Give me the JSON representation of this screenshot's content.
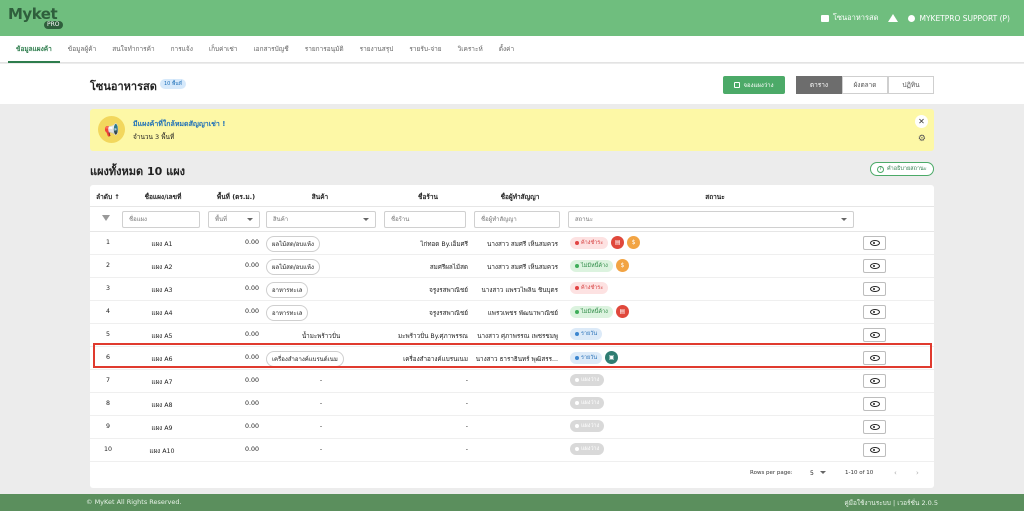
{
  "app": {
    "logo": "Myket",
    "logo_sub": "PRO"
  },
  "topbar": {
    "shop_label": "โซนอาหารสด",
    "user_label": "MYKETPRO SUPPORT (P)"
  },
  "menu": [
    "ข้อมูลแผงค้า",
    "ข้อมูลผู้ค้า",
    "สนใจทำการค้า",
    "การแจ้ง",
    "เก็บค่าเช่า",
    "เอกสารบัญชี",
    "รายการอนุมัติ",
    "รายงานสรุป",
    "รายรับ-จ่าย",
    "วิเคราะห์",
    "ตั้งค่า"
  ],
  "page": {
    "title": "โซนอาหารสด",
    "count_badge": "10 พื้นที่",
    "reserve_button": "จองแผงว่าง",
    "views": [
      "ตาราง",
      "ผังตลาด",
      "ปฏิทิน"
    ],
    "active_view": "ตาราง"
  },
  "alert": {
    "title": "มีแผงค้าที่ใกล้หมดสัญญาเช่า !",
    "sub": "จำนวน 3 พื้นที่"
  },
  "section": {
    "title": "แผงทั้งหมด 10 แผง",
    "status_help": "คำอธิบายสถานะ"
  },
  "table": {
    "headers": [
      "ลำดับ",
      "ชื่อแผง/เลขที่",
      "พื้นที่ (ตร.ม.)",
      "สินค้า",
      "ชื่อร้าน",
      "ชื่อผู้ทำสัญญา",
      "สถานะ"
    ],
    "filters": {
      "name": "ชื่อแผง",
      "area": "พื้นที่",
      "product": "สินค้า",
      "shop": "ชื่อร้าน",
      "tenant": "ชื่อผู้ทำสัญญา",
      "status": "สถานะ"
    },
    "rows": [
      {
        "no": "1",
        "name": "แผง A1",
        "area": "0.00",
        "product": "ผลไม้สด/อบแห้ง",
        "product_chip": true,
        "shop": "ไก่ทอด By.เอ็มศรี",
        "tenant": "นางสาว สมศรี เห็นสมควร",
        "status": "ค้างชำระ",
        "status_type": "red",
        "icons": [
          "doc",
          "coin"
        ]
      },
      {
        "no": "2",
        "name": "แผง A2",
        "area": "0.00",
        "product": "ผลไม้สด/อบแห้ง",
        "product_chip": true,
        "shop": "สมศรีผลไม้สด",
        "tenant": "นางสาว สมศรี เห็นสมควร",
        "status": "ไม่มีหนี้ค้าง",
        "status_type": "green",
        "icons": [
          "coin"
        ]
      },
      {
        "no": "3",
        "name": "แผง A3",
        "area": "0.00",
        "product": "อาหารทะเล",
        "product_chip": true,
        "shop": "จรูงรสพาณิชย์",
        "tenant": "นางสาว แพรวไพลิน ชินบุตร",
        "status": "ค้างชำระ",
        "status_type": "red",
        "icons": []
      },
      {
        "no": "4",
        "name": "แผง A4",
        "area": "0.00",
        "product": "อาหารทะเล",
        "product_chip": true,
        "shop": "จรูงรสพาณิชย์",
        "tenant": "แพรวเพชร พัฒนาพาณิชย์",
        "status": "ไม่มีหนี้ค้าง",
        "status_type": "green",
        "icons": [
          "doc"
        ]
      },
      {
        "no": "5",
        "name": "แผง A5",
        "area": "0.00",
        "product": "น้ำมะพร้าวปั่น",
        "product_chip": false,
        "shop": "มะพร้าวปั่น By.ศุภาพรรณ",
        "tenant": "นางสาว ศุภาพรรณ เพชรชมพู",
        "status": "รายวัน",
        "status_type": "blue",
        "icons": []
      },
      {
        "no": "6",
        "name": "แผง A6",
        "area": "0.00",
        "product": "เครื่องสำอางค์แบรนด์เนม",
        "product_chip": true,
        "shop": "เครื่องสำอางค์แบรนเนม",
        "tenant": "นางสาว ธาราธินทร์ พุฒิสรร...",
        "status": "รายวัน",
        "status_type": "blue",
        "icons": [
          "teal"
        ]
      },
      {
        "no": "7",
        "name": "แผง A7",
        "area": "0.00",
        "product": "-",
        "product_chip": false,
        "shop": "-",
        "tenant": "",
        "status": "แผงว่าง",
        "status_type": "gray",
        "icons": []
      },
      {
        "no": "8",
        "name": "แผง A8",
        "area": "0.00",
        "product": "-",
        "product_chip": false,
        "shop": "-",
        "tenant": "",
        "status": "แผงว่าง",
        "status_type": "gray",
        "icons": []
      },
      {
        "no": "9",
        "name": "แผง A9",
        "area": "0.00",
        "product": "-",
        "product_chip": false,
        "shop": "-",
        "tenant": "",
        "status": "แผงว่าง",
        "status_type": "gray",
        "icons": []
      },
      {
        "no": "10",
        "name": "แผง A10",
        "area": "0.00",
        "product": "-",
        "product_chip": false,
        "shop": "-",
        "tenant": "",
        "status": "แผงว่าง",
        "status_type": "gray",
        "icons": []
      }
    ]
  },
  "pager": {
    "rows_label": "Rows per page:",
    "rows_value": "5",
    "range": "1-10 of 10"
  },
  "footer": {
    "left": "© MyKet All Rights Reserved.",
    "right": "คู่มือใช้งานระบบ | เวอร์ชั่น 2.0.5"
  },
  "colors": {
    "brand": "#6fbe7e",
    "accent": "#4caa68",
    "highlight": "#e03a2e"
  }
}
